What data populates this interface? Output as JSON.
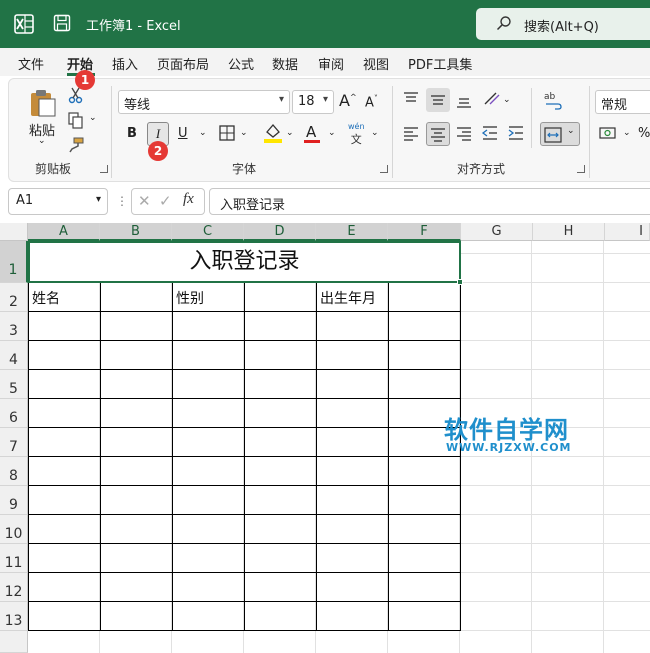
{
  "titlebar": {
    "doc_title": "工作簿1  -  Excel",
    "search_label": "搜索(Alt+Q)"
  },
  "menu": [
    "文件",
    "开始",
    "插入",
    "页面布局",
    "公式",
    "数据",
    "审阅",
    "视图",
    "PDF工具集"
  ],
  "ribbon": {
    "paste_label": "粘贴",
    "clipboard_label": "剪贴板",
    "font_name": "等线",
    "font_size": "18",
    "grow_font": "A",
    "shrink_font": "A",
    "bold": "B",
    "italic": "I",
    "underline": "U",
    "font_color": "A",
    "phonetic_top": "wén",
    "phonetic_bottom": "文",
    "font_label": "字体",
    "align_label": "对齐方式",
    "number_format": "常规"
  },
  "badges": [
    "1",
    "2"
  ],
  "formula_bar": {
    "name_box": "A1",
    "fx": "fx",
    "formula": "入职登记录"
  },
  "columns": [
    "A",
    "B",
    "C",
    "D",
    "E",
    "F",
    "G",
    "H",
    "I"
  ],
  "rows": [
    "1",
    "2",
    "3",
    "4",
    "5",
    "6",
    "7",
    "8",
    "9",
    "10",
    "11",
    "12",
    "13"
  ],
  "sheet": {
    "title": "入职登记录",
    "row2": [
      "姓名",
      "",
      "性别",
      "",
      "出生年月",
      ""
    ]
  },
  "watermark": {
    "title": "软件自学网",
    "url": "WWW.RJZXW.COM"
  },
  "colors": {
    "excel_green": "#217346",
    "badge_red": "#e53935",
    "watermark_blue": "#1f8fcc"
  }
}
